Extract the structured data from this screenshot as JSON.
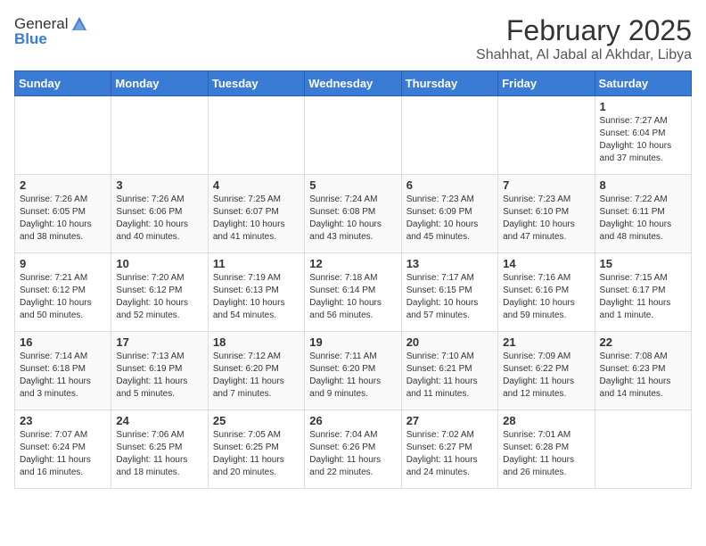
{
  "header": {
    "logo_general": "General",
    "logo_blue": "Blue",
    "month_title": "February 2025",
    "location": "Shahhat, Al Jabal al Akhdar, Libya"
  },
  "days_of_week": [
    "Sunday",
    "Monday",
    "Tuesday",
    "Wednesday",
    "Thursday",
    "Friday",
    "Saturday"
  ],
  "weeks": [
    [
      {
        "day": "",
        "text": ""
      },
      {
        "day": "",
        "text": ""
      },
      {
        "day": "",
        "text": ""
      },
      {
        "day": "",
        "text": ""
      },
      {
        "day": "",
        "text": ""
      },
      {
        "day": "",
        "text": ""
      },
      {
        "day": "1",
        "text": "Sunrise: 7:27 AM\nSunset: 6:04 PM\nDaylight: 10 hours and 37 minutes."
      }
    ],
    [
      {
        "day": "2",
        "text": "Sunrise: 7:26 AM\nSunset: 6:05 PM\nDaylight: 10 hours and 38 minutes."
      },
      {
        "day": "3",
        "text": "Sunrise: 7:26 AM\nSunset: 6:06 PM\nDaylight: 10 hours and 40 minutes."
      },
      {
        "day": "4",
        "text": "Sunrise: 7:25 AM\nSunset: 6:07 PM\nDaylight: 10 hours and 41 minutes."
      },
      {
        "day": "5",
        "text": "Sunrise: 7:24 AM\nSunset: 6:08 PM\nDaylight: 10 hours and 43 minutes."
      },
      {
        "day": "6",
        "text": "Sunrise: 7:23 AM\nSunset: 6:09 PM\nDaylight: 10 hours and 45 minutes."
      },
      {
        "day": "7",
        "text": "Sunrise: 7:23 AM\nSunset: 6:10 PM\nDaylight: 10 hours and 47 minutes."
      },
      {
        "day": "8",
        "text": "Sunrise: 7:22 AM\nSunset: 6:11 PM\nDaylight: 10 hours and 48 minutes."
      }
    ],
    [
      {
        "day": "9",
        "text": "Sunrise: 7:21 AM\nSunset: 6:12 PM\nDaylight: 10 hours and 50 minutes."
      },
      {
        "day": "10",
        "text": "Sunrise: 7:20 AM\nSunset: 6:12 PM\nDaylight: 10 hours and 52 minutes."
      },
      {
        "day": "11",
        "text": "Sunrise: 7:19 AM\nSunset: 6:13 PM\nDaylight: 10 hours and 54 minutes."
      },
      {
        "day": "12",
        "text": "Sunrise: 7:18 AM\nSunset: 6:14 PM\nDaylight: 10 hours and 56 minutes."
      },
      {
        "day": "13",
        "text": "Sunrise: 7:17 AM\nSunset: 6:15 PM\nDaylight: 10 hours and 57 minutes."
      },
      {
        "day": "14",
        "text": "Sunrise: 7:16 AM\nSunset: 6:16 PM\nDaylight: 10 hours and 59 minutes."
      },
      {
        "day": "15",
        "text": "Sunrise: 7:15 AM\nSunset: 6:17 PM\nDaylight: 11 hours and 1 minute."
      }
    ],
    [
      {
        "day": "16",
        "text": "Sunrise: 7:14 AM\nSunset: 6:18 PM\nDaylight: 11 hours and 3 minutes."
      },
      {
        "day": "17",
        "text": "Sunrise: 7:13 AM\nSunset: 6:19 PM\nDaylight: 11 hours and 5 minutes."
      },
      {
        "day": "18",
        "text": "Sunrise: 7:12 AM\nSunset: 6:20 PM\nDaylight: 11 hours and 7 minutes."
      },
      {
        "day": "19",
        "text": "Sunrise: 7:11 AM\nSunset: 6:20 PM\nDaylight: 11 hours and 9 minutes."
      },
      {
        "day": "20",
        "text": "Sunrise: 7:10 AM\nSunset: 6:21 PM\nDaylight: 11 hours and 11 minutes."
      },
      {
        "day": "21",
        "text": "Sunrise: 7:09 AM\nSunset: 6:22 PM\nDaylight: 11 hours and 12 minutes."
      },
      {
        "day": "22",
        "text": "Sunrise: 7:08 AM\nSunset: 6:23 PM\nDaylight: 11 hours and 14 minutes."
      }
    ],
    [
      {
        "day": "23",
        "text": "Sunrise: 7:07 AM\nSunset: 6:24 PM\nDaylight: 11 hours and 16 minutes."
      },
      {
        "day": "24",
        "text": "Sunrise: 7:06 AM\nSunset: 6:25 PM\nDaylight: 11 hours and 18 minutes."
      },
      {
        "day": "25",
        "text": "Sunrise: 7:05 AM\nSunset: 6:25 PM\nDaylight: 11 hours and 20 minutes."
      },
      {
        "day": "26",
        "text": "Sunrise: 7:04 AM\nSunset: 6:26 PM\nDaylight: 11 hours and 22 minutes."
      },
      {
        "day": "27",
        "text": "Sunrise: 7:02 AM\nSunset: 6:27 PM\nDaylight: 11 hours and 24 minutes."
      },
      {
        "day": "28",
        "text": "Sunrise: 7:01 AM\nSunset: 6:28 PM\nDaylight: 11 hours and 26 minutes."
      },
      {
        "day": "",
        "text": ""
      }
    ]
  ]
}
